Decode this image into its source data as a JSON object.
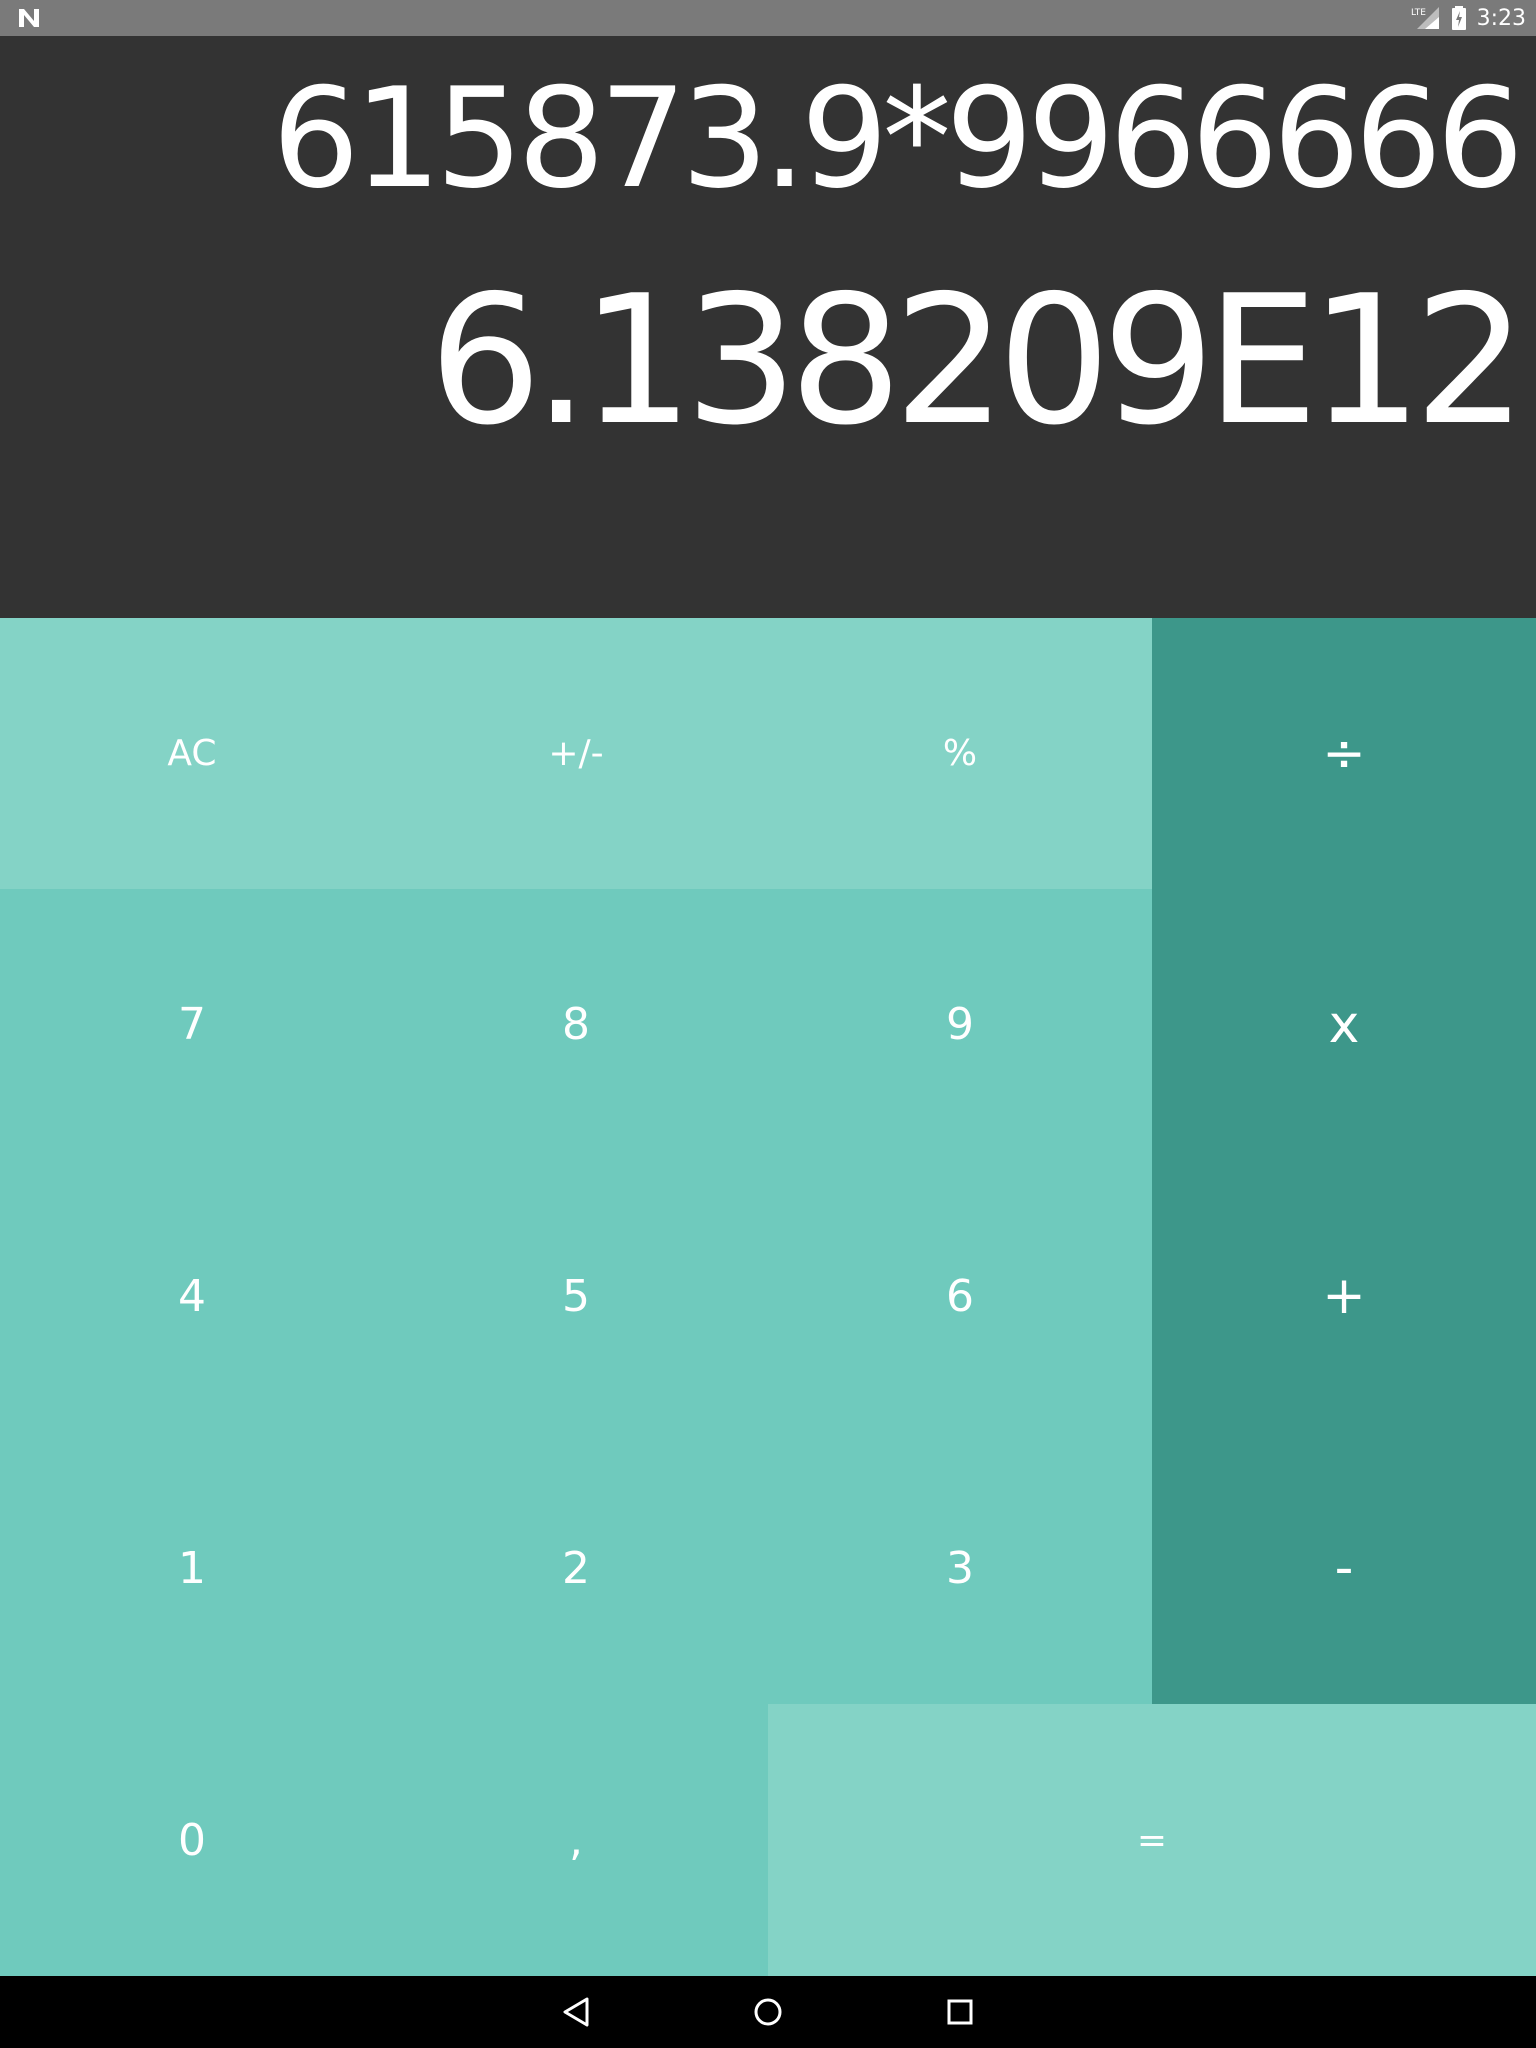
{
  "status_bar": {
    "time": "3:23",
    "network": "LTE",
    "icons": [
      "n-logo-icon",
      "signal-icon",
      "battery-icon"
    ]
  },
  "display": {
    "expression": "615873.9*9966666",
    "result": "6.138209E12"
  },
  "keys": {
    "ac": "AC",
    "sign": "+/-",
    "percent": "%",
    "divide": "÷",
    "seven": "7",
    "eight": "8",
    "nine": "9",
    "multiply": "x",
    "four": "4",
    "five": "5",
    "six": "6",
    "plus": "+",
    "one": "1",
    "two": "2",
    "three": "3",
    "minus": "-",
    "zero": "0",
    "comma": ",",
    "equals": "="
  },
  "nav_bar": {
    "icons": [
      "back-icon",
      "home-icon",
      "recents-icon"
    ]
  },
  "colors": {
    "display_bg": "#333333",
    "key_light": "#84d3c6",
    "key_mid": "#6fcabd",
    "key_operator": "#3d978a",
    "status_bar": "#7a7a7a",
    "nav_bar": "#000000"
  }
}
